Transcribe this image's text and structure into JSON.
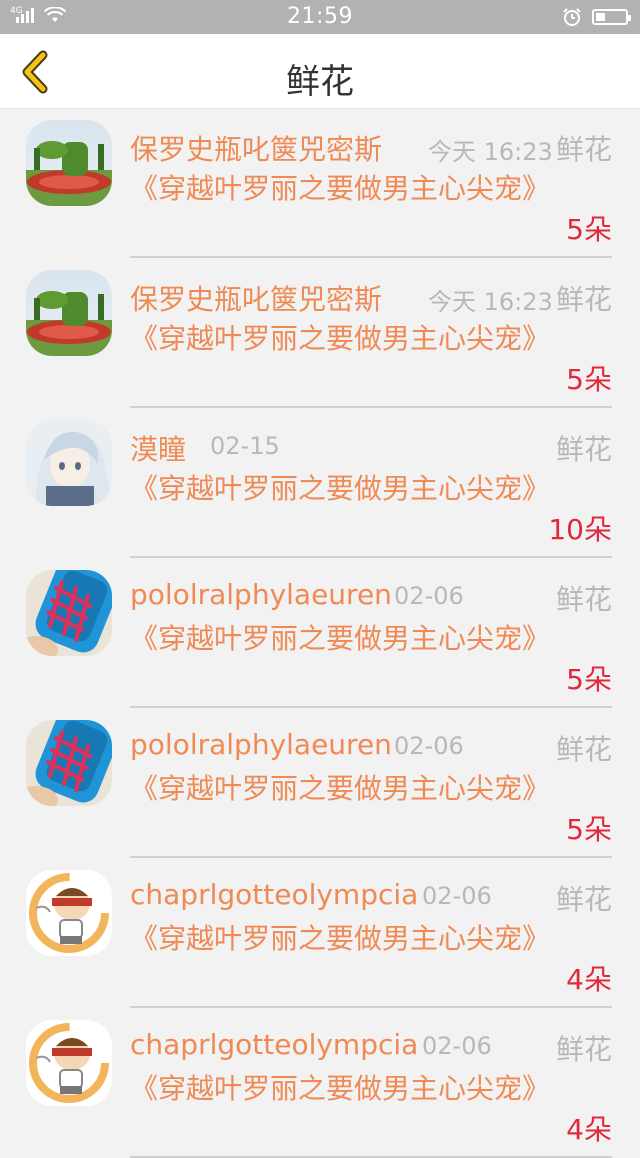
{
  "status_bar": {
    "time": "21:59",
    "network": "4G"
  },
  "header": {
    "title": "鲜花"
  },
  "records": [
    {
      "name": "保罗史瓶叱箧兕密斯",
      "date": "今天 16:23",
      "gift": "鲜花",
      "book": "《穿越叶罗丽之要做男主心尖宠》",
      "count": "5朵",
      "avatar": "garden"
    },
    {
      "name": "保罗史瓶叱箧兕密斯",
      "date": "今天 16:23",
      "gift": "鲜花",
      "book": "《穿越叶罗丽之要做男主心尖宠》",
      "count": "5朵",
      "avatar": "garden"
    },
    {
      "name": "漠瞳",
      "date": "02-15",
      "gift": "鲜花",
      "book": "《穿越叶罗丽之要做男主心尖宠》",
      "count": "10朵",
      "avatar": "anime"
    },
    {
      "name": "pololralphylaeuren",
      "date": "02-06",
      "gift": "鲜花",
      "book": "《穿越叶罗丽之要做男主心尖宠》",
      "count": "5朵",
      "avatar": "shoe"
    },
    {
      "name": "pololralphylaeuren",
      "date": "02-06",
      "gift": "鲜花",
      "book": "《穿越叶罗丽之要做男主心尖宠》",
      "count": "5朵",
      "avatar": "shoe"
    },
    {
      "name": "chaprlgotteolympcia",
      "date": "02-06",
      "gift": "鲜花",
      "book": "《穿越叶罗丽之要做男主心尖宠》",
      "count": "4朵",
      "avatar": "cartoon"
    },
    {
      "name": "chaprlgotteolympcia",
      "date": "02-06",
      "gift": "鲜花",
      "book": "《穿越叶罗丽之要做男主心尖宠》",
      "count": "4朵",
      "avatar": "cartoon"
    }
  ],
  "colors": {
    "name": "#f08a55",
    "count": "#e02a3c",
    "muted": "#b8b8b8",
    "back_icon": "#f2c318"
  }
}
